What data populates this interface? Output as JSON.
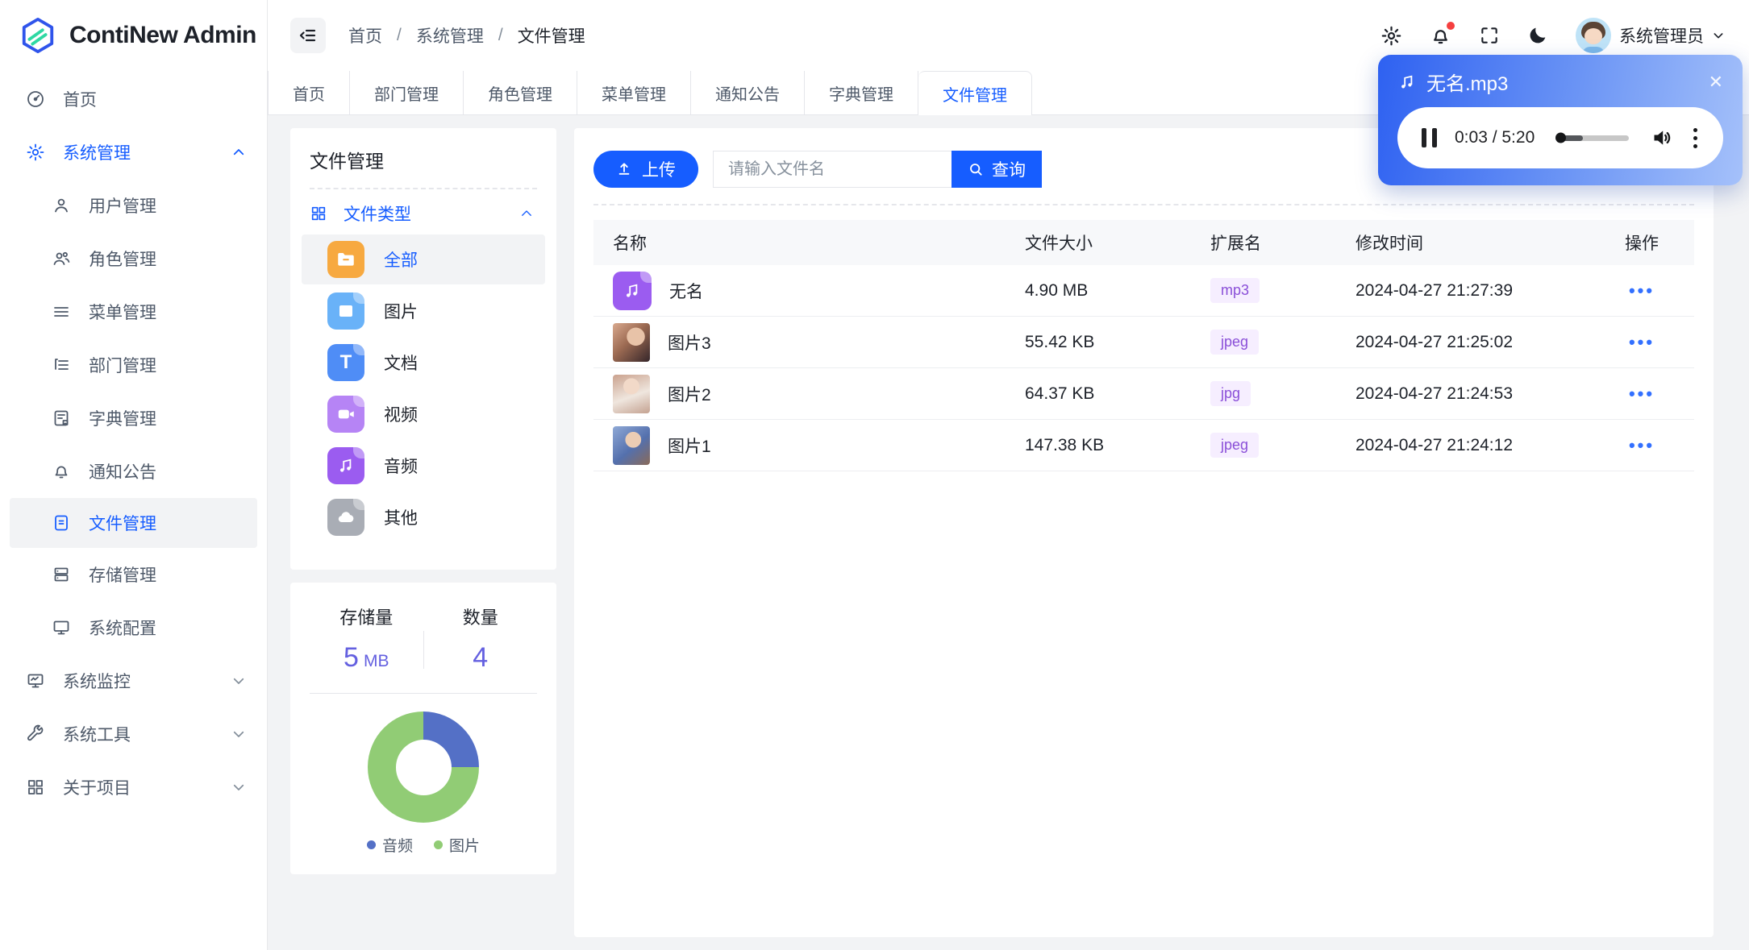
{
  "app": {
    "name": "ContiNew Admin"
  },
  "breadcrumb": {
    "items": [
      "首页",
      "系统管理",
      "文件管理"
    ]
  },
  "header": {
    "user_name": "系统管理员"
  },
  "tabs": {
    "items": [
      {
        "label": "首页"
      },
      {
        "label": "部门管理"
      },
      {
        "label": "角色管理"
      },
      {
        "label": "菜单管理"
      },
      {
        "label": "通知公告"
      },
      {
        "label": "字典管理"
      },
      {
        "label": "文件管理",
        "active": true
      }
    ]
  },
  "sidebar": {
    "home": "首页",
    "system": "系统管理",
    "children": {
      "user": "用户管理",
      "role": "角色管理",
      "menu": "菜单管理",
      "dept": "部门管理",
      "dict": "字典管理",
      "notice": "通知公告",
      "file": "文件管理",
      "storage": "存储管理",
      "config": "系统配置"
    },
    "monitor": "系统监控",
    "tools": "系统工具",
    "about": "关于项目"
  },
  "file_panel": {
    "title": "文件管理",
    "group_label": "文件类型",
    "types": [
      {
        "label": "全部",
        "active": true
      },
      {
        "label": "图片"
      },
      {
        "label": "文档"
      },
      {
        "label": "视频"
      },
      {
        "label": "音频"
      },
      {
        "label": "其他"
      }
    ]
  },
  "stats": {
    "storage_label": "存储量",
    "storage_value": "5",
    "storage_unit": "MB",
    "count_label": "数量",
    "count_value": "4"
  },
  "chart_data": {
    "type": "pie",
    "donut": true,
    "categories": [
      "音频",
      "图片"
    ],
    "values": [
      1,
      3
    ],
    "percents": [
      25,
      75
    ],
    "colors": [
      "#5470c6",
      "#91cc75"
    ],
    "legend_position": "bottom"
  },
  "toolbar": {
    "upload_label": "上传",
    "search_placeholder": "请输入文件名",
    "query_label": "查询"
  },
  "table": {
    "columns": [
      "名称",
      "文件大小",
      "扩展名",
      "修改时间",
      "操作"
    ],
    "ops_glyph": "•••",
    "rows": [
      {
        "name": "无名",
        "size": "4.90 MB",
        "ext": "mp3",
        "time": "2024-04-27 21:27:39"
      },
      {
        "name": "图片3",
        "size": "55.42 KB",
        "ext": "jpeg",
        "time": "2024-04-27 21:25:02"
      },
      {
        "name": "图片2",
        "size": "64.37 KB",
        "ext": "jpg",
        "time": "2024-04-27 21:24:53"
      },
      {
        "name": "图片1",
        "size": "147.38 KB",
        "ext": "jpeg",
        "time": "2024-04-27 21:24:12"
      }
    ]
  },
  "player": {
    "title": "无名.mp3",
    "time_display": "0:03 / 5:20"
  },
  "colors": {
    "primary": "#165dff"
  }
}
